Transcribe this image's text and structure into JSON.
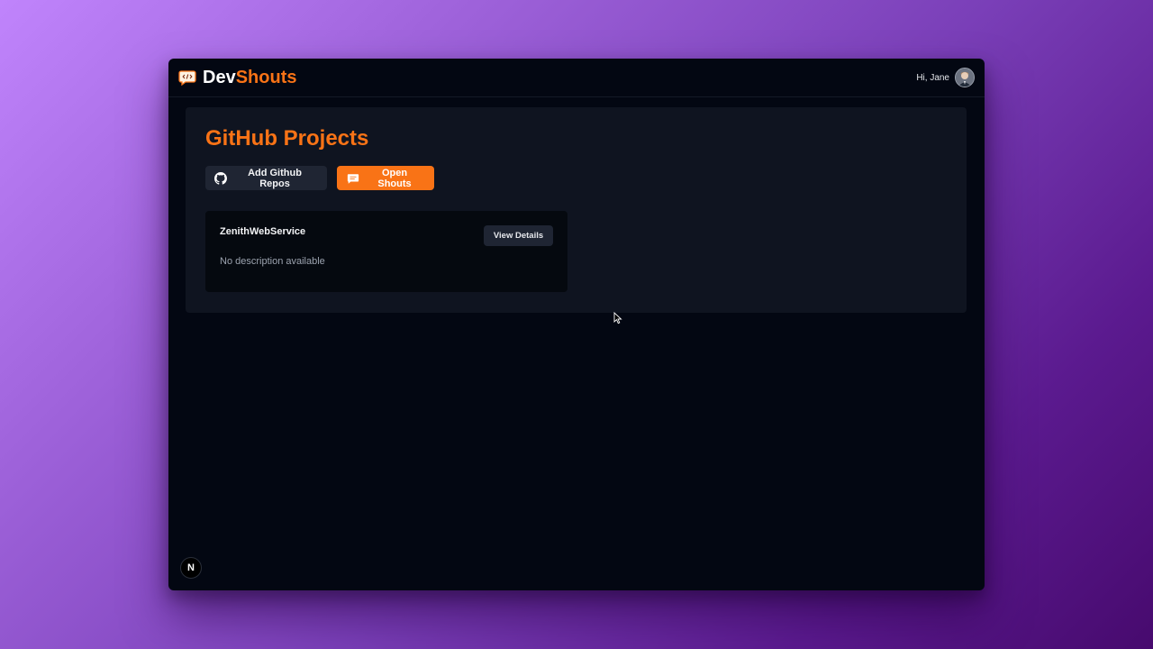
{
  "app": {
    "brand_part1": "Dev",
    "brand_part2": "Shouts",
    "brand_icon": "chat-code-icon",
    "accent_color": "#f97316"
  },
  "header": {
    "greeting": "Hi, Jane",
    "avatar": "user-avatar"
  },
  "main": {
    "title": "GitHub Projects",
    "actions": {
      "add_repos_label": "Add Github Repos",
      "add_repos_icon": "github-icon",
      "open_shouts_label": "Open Shouts",
      "open_shouts_icon": "message-icon"
    },
    "repos": [
      {
        "name": "ZenithWebService",
        "description": "No description available",
        "details_label": "View Details"
      }
    ]
  },
  "footer": {
    "badge_letter": "N",
    "badge_icon": "nextjs-icon"
  }
}
